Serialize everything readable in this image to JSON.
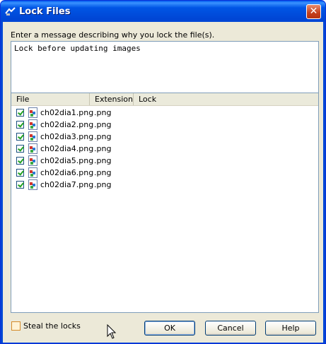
{
  "window": {
    "title": "Lock Files",
    "close_label": "✕"
  },
  "message": {
    "label": "Enter a message describing why you lock the file(s).",
    "value": "Lock before updating images"
  },
  "list": {
    "columns": [
      "File",
      "Extension",
      "Lock"
    ],
    "rows": [
      {
        "file": "ch02dia1.png",
        "ext": ".png",
        "checked": true
      },
      {
        "file": "ch02dia2.png",
        "ext": ".png",
        "checked": true
      },
      {
        "file": "ch02dia3.png",
        "ext": ".png",
        "checked": true
      },
      {
        "file": "ch02dia4.png",
        "ext": ".png",
        "checked": true
      },
      {
        "file": "ch02dia5.png",
        "ext": ".png",
        "checked": true
      },
      {
        "file": "ch02dia6.png",
        "ext": ".png",
        "checked": true
      },
      {
        "file": "ch02dia7.png",
        "ext": ".png",
        "checked": true
      }
    ]
  },
  "steal_locks": {
    "label": "Steal the locks",
    "checked": false
  },
  "buttons": {
    "ok": "OK",
    "cancel": "Cancel",
    "help": "Help"
  }
}
